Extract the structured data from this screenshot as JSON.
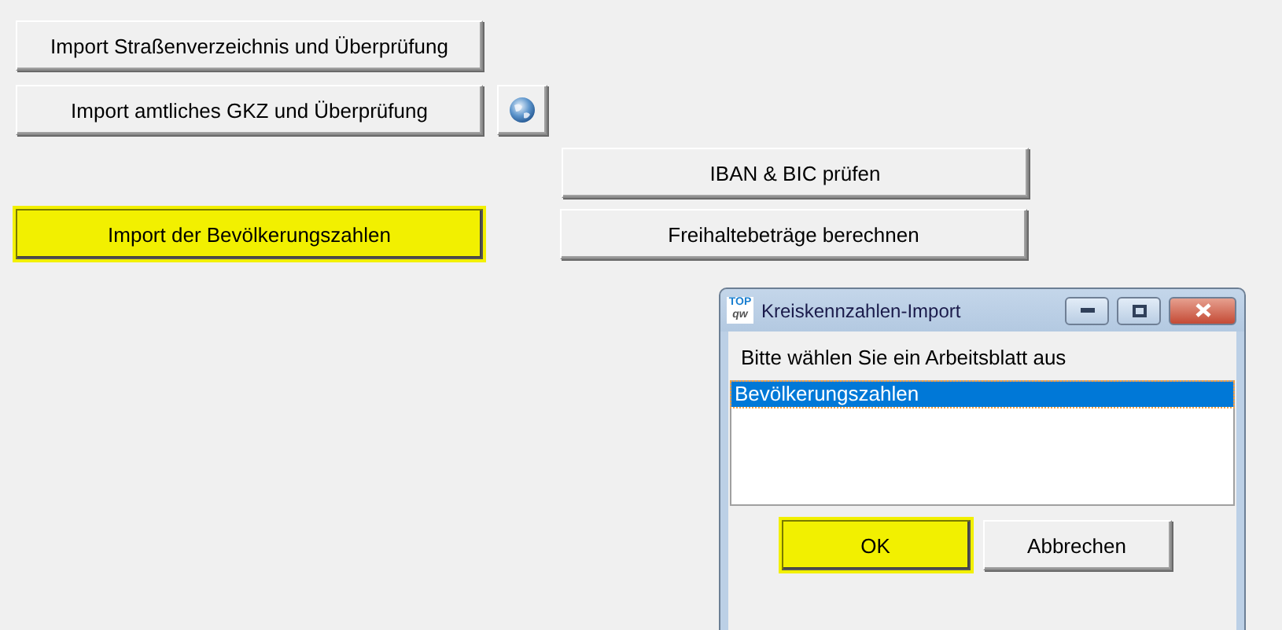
{
  "buttons": [
    {
      "label": "Import Straßenverzeichnis und Überprüfung",
      "highlighted": false
    },
    {
      "label": "Import amtliches GKZ und Überprüfung",
      "highlighted": false
    },
    {
      "label": "IBAN & BIC prüfen",
      "highlighted": false
    },
    {
      "label": "Import der Bevölkerungszahlen",
      "highlighted": true
    },
    {
      "label": "Freihaltebeträge berechnen",
      "highlighted": false
    }
  ],
  "dialog": {
    "logo": [
      "TOP",
      "qw"
    ],
    "title": "Kreiskennzahlen-Import",
    "prompt": "Bitte wählen Sie ein Arbeitsblatt aus",
    "items": [
      {
        "label": "Bevölkerungszahlen",
        "selected": true
      }
    ],
    "buttons": [
      {
        "label": "OK",
        "highlighted": true
      },
      {
        "label": "Abbrechen",
        "highlighted": false
      }
    ]
  }
}
